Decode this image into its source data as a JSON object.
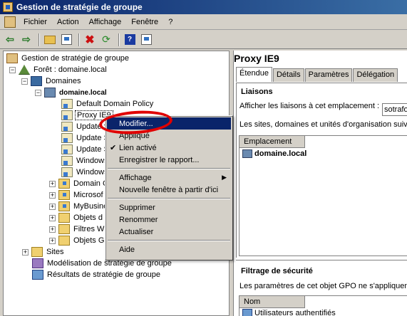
{
  "window": {
    "title": "Gestion de stratégie de groupe"
  },
  "menu": [
    "Fichier",
    "Action",
    "Affichage",
    "Fenêtre",
    "?"
  ],
  "tree": {
    "root": "Gestion de stratégie de groupe",
    "forest": "Forêt : domaine.local",
    "domains": "Domaines",
    "domain": "domaine.local",
    "items": [
      "Default Domain Policy",
      "Proxy IE9",
      "Update S",
      "Update S",
      "Update S",
      "Windows",
      "Windows",
      "Domain C",
      "Microsof",
      "MyBusine",
      "Objets d",
      "Filtres W",
      "Objets G"
    ],
    "sites": "Sites",
    "modeling": "Modélisation de stratégie de groupe",
    "results": "Résultats de stratégie de groupe"
  },
  "right": {
    "title": "Proxy IE9",
    "tabs": [
      "Étendue",
      "Détails",
      "Paramètres",
      "Délégation"
    ],
    "links_title": "Liaisons",
    "links_label": "Afficher les liaisons à cet emplacement :",
    "links_combo": "sotrafo",
    "links_desc": "Les sites, domaines et unités d'organisation suivan",
    "links_column": "Emplacement",
    "links_rows": [
      "domaine.local"
    ],
    "security_title": "Filtrage de sécurité",
    "security_desc": "Les paramètres de cet objet GPO ne s'appliquent",
    "security_column": "Nom",
    "security_rows": [
      "Utilisateurs authentifiés"
    ]
  },
  "context_menu": {
    "items": [
      {
        "label": "Modifier...",
        "highlight": true
      },
      {
        "label": "Appliqué"
      },
      {
        "label": "Lien activé",
        "checked": true
      },
      {
        "label": "Enregistrer le rapport..."
      },
      {
        "label": "Affichage",
        "submenu": true
      },
      {
        "label": "Nouvelle fenêtre à partir d'ici"
      },
      {
        "label": "Supprimer"
      },
      {
        "label": "Renommer"
      },
      {
        "label": "Actualiser"
      },
      {
        "label": "Aide"
      }
    ]
  },
  "colors": {
    "highlight": "#0a246a",
    "annotation": "#e00000",
    "title_gradient_start": "#0a246a"
  }
}
